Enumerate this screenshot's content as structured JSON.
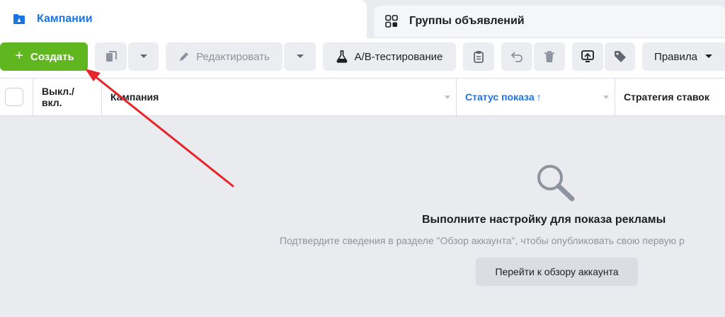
{
  "tabs": {
    "campaigns": "Кампании",
    "adsets": "Группы объявлений"
  },
  "toolbar": {
    "create": "Создать",
    "edit": "Редактировать",
    "ab_test": "A/B-тестирование",
    "rules": "Правила"
  },
  "table": {
    "col_onoff": "Выкл./\nвкл.",
    "col_campaign": "Кампания",
    "col_status": "Статус показа",
    "col_status_sort": "↑",
    "col_strategy": "Стратегия ставок"
  },
  "empty_state": {
    "title": "Выполните настройку для показа рекламы",
    "subtitle": "Подтвердите сведения в разделе \"Обзор аккаунта\", чтобы опубликовать свою первую р",
    "button": "Перейти к обзору аккаунта"
  },
  "colors": {
    "accent_blue": "#1b74e4",
    "create_green": "#5fb61f",
    "annotation_arrow": "#e8242b"
  },
  "icons": {
    "campaigns_tab": "folder-flag-icon",
    "adsets_tab": "grid-icon",
    "duplicate": "copy-icon",
    "edit": "pencil-icon",
    "ab_test": "flask-icon",
    "clipboard": "clipboard-icon",
    "undo": "undo-icon",
    "delete": "trash-icon",
    "export": "export-icon",
    "tag": "tag-icon",
    "empty_search": "search-icon"
  }
}
